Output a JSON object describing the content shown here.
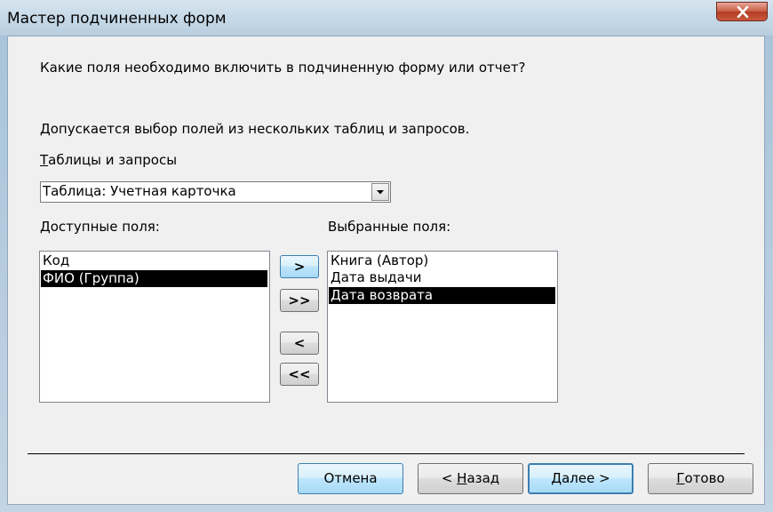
{
  "window": {
    "title": "Мастер подчиненных форм"
  },
  "prompt": {
    "question": "Какие поля необходимо включить в подчиненную форму или отчет?",
    "hint": "Допускается выбор полей из нескольких таблиц и запросов."
  },
  "source": {
    "label_first": "Т",
    "label_rest": "аблицы и запросы",
    "selected": "Таблица: Учетная карточка"
  },
  "available": {
    "label": "Доступные поля:",
    "items": [
      "Код",
      "ФИО (Группа)"
    ],
    "selected_index": 1
  },
  "chosen": {
    "label": "Выбранные поля:",
    "items": [
      "Книга (Автор)",
      "Дата выдачи",
      "Дата возврата"
    ],
    "selected_index": 2
  },
  "move_buttons": {
    "add_one": ">",
    "add_all": ">>",
    "remove_one": "<",
    "remove_all": "<<"
  },
  "footer": {
    "cancel": "Отмена",
    "back_prefix": "< ",
    "back_key": "Н",
    "back_rest": "азад",
    "next_key": "Д",
    "next_rest": "алее >",
    "finish_key": "Г",
    "finish_rest": "отово"
  },
  "colors": {
    "selection": "#000000",
    "default_button": "#bee6fd",
    "close_button": "#c75a41"
  }
}
